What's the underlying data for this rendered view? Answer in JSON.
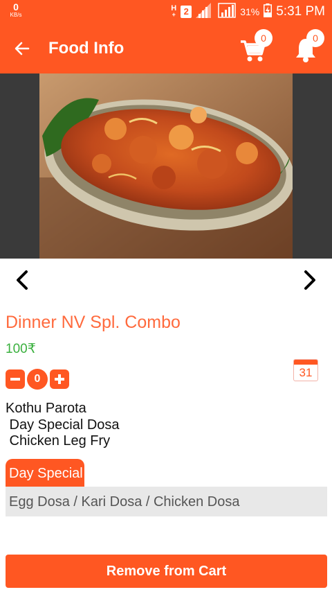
{
  "status_bar": {
    "net_speed": "0",
    "net_unit": "KB/s",
    "network_type": "H",
    "network_type_sub": "+",
    "sim_slot": "2",
    "battery_percent": "31%",
    "time": "5:31 PM"
  },
  "app_bar": {
    "title": "Food Info",
    "cart_count": "0",
    "notification_count": "0"
  },
  "product": {
    "name": "Dinner NV Spl. Combo",
    "price": "100₹",
    "quantity": "0",
    "calendar_day": "31",
    "items_text": "Kothu Parota\n Day Special Dosa\n Chicken Leg Fry",
    "day_special_label": "Day Special",
    "day_special_options": "Egg Dosa / Kari Dosa / Chicken Dosa"
  },
  "actions": {
    "remove_label": "Remove from Cart"
  },
  "colors": {
    "accent": "#ff5722",
    "dish_name": "#ff6a3d",
    "price": "#3ab03e"
  }
}
